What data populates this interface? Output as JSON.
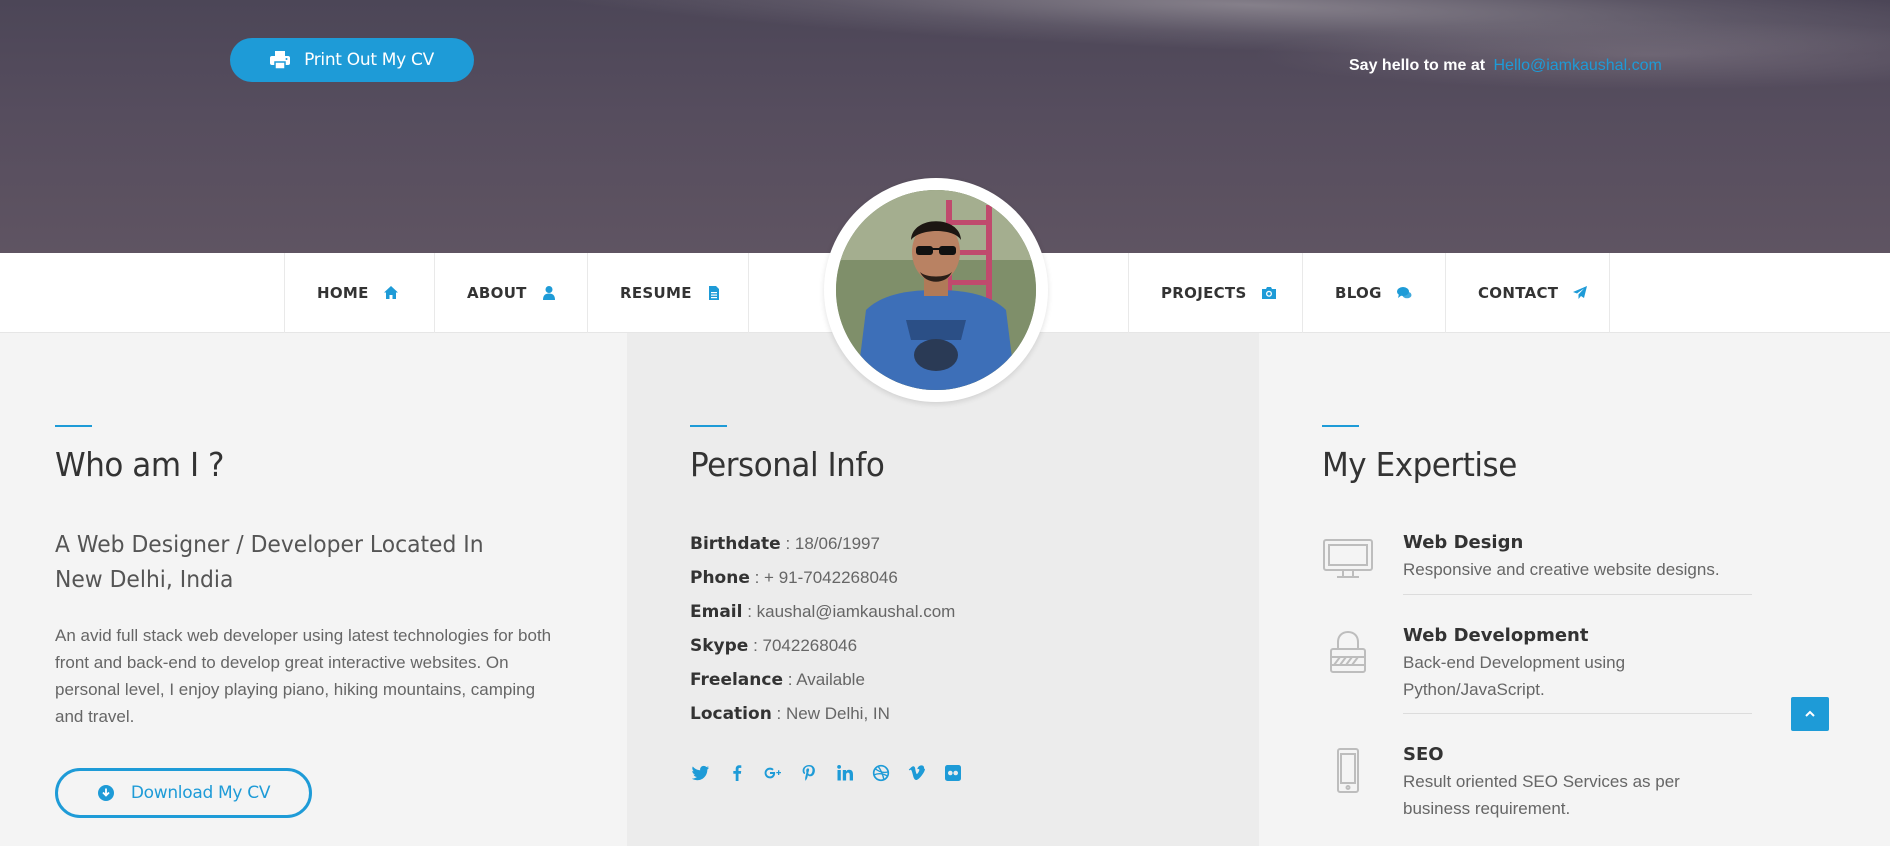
{
  "header": {
    "print_button_label": "Print Out My CV",
    "hello_prefix": "Say hello to me at",
    "hello_email": "Hello@iamkaushal.com"
  },
  "nav": {
    "items": [
      {
        "label": "HOME",
        "icon": "home-icon"
      },
      {
        "label": "ABOUT",
        "icon": "user-icon"
      },
      {
        "label": "RESUME",
        "icon": "file-icon"
      },
      {
        "label": "PROJECTS",
        "icon": "camera-icon"
      },
      {
        "label": "BLOG",
        "icon": "comments-icon"
      },
      {
        "label": "CONTACT",
        "icon": "paper-plane-icon"
      }
    ]
  },
  "about": {
    "title": "Who am I ?",
    "subtitle": "A Web Designer / Developer Located In New Delhi, India",
    "text": "An avid full stack web developer using latest technologies for both front and back-end to develop great interactive websites. On personal level, I enjoy playing piano, hiking mountains, camping and travel.",
    "download_button_label": "Download My CV"
  },
  "personal": {
    "title": "Personal Info",
    "rows": [
      {
        "key": "Birthdate",
        "value": ": 18/06/1997"
      },
      {
        "key": "Phone",
        "value": ": + 91-7042268046"
      },
      {
        "key": "Email",
        "value": ": kaushal@iamkaushal.com"
      },
      {
        "key": "Skype",
        "value": ": 7042268046"
      },
      {
        "key": "Freelance",
        "value": ": Available"
      },
      {
        "key": "Location",
        "value": ": New Delhi, IN"
      }
    ],
    "socials": [
      "twitter-icon",
      "facebook-icon",
      "google-plus-icon",
      "pinterest-icon",
      "linkedin-icon",
      "dribbble-icon",
      "vimeo-icon",
      "flickr-icon"
    ]
  },
  "expertise": {
    "title": "My Expertise",
    "items": [
      {
        "title": "Web Design",
        "desc": "Responsive and creative website designs.",
        "icon": "monitor-icon"
      },
      {
        "title": "Web Development",
        "desc": "Back-end Development using Python/JavaScript.",
        "icon": "lock-icon"
      },
      {
        "title": "SEO",
        "desc": "Result oriented SEO Services as per business requirement.",
        "icon": "mobile-icon"
      }
    ]
  },
  "colors": {
    "accent": "#1e9bd7",
    "hero": "#564d5e",
    "nav_bg": "#ffffff",
    "col_light": "#f4f4f4",
    "col_mid": "#ececec"
  }
}
